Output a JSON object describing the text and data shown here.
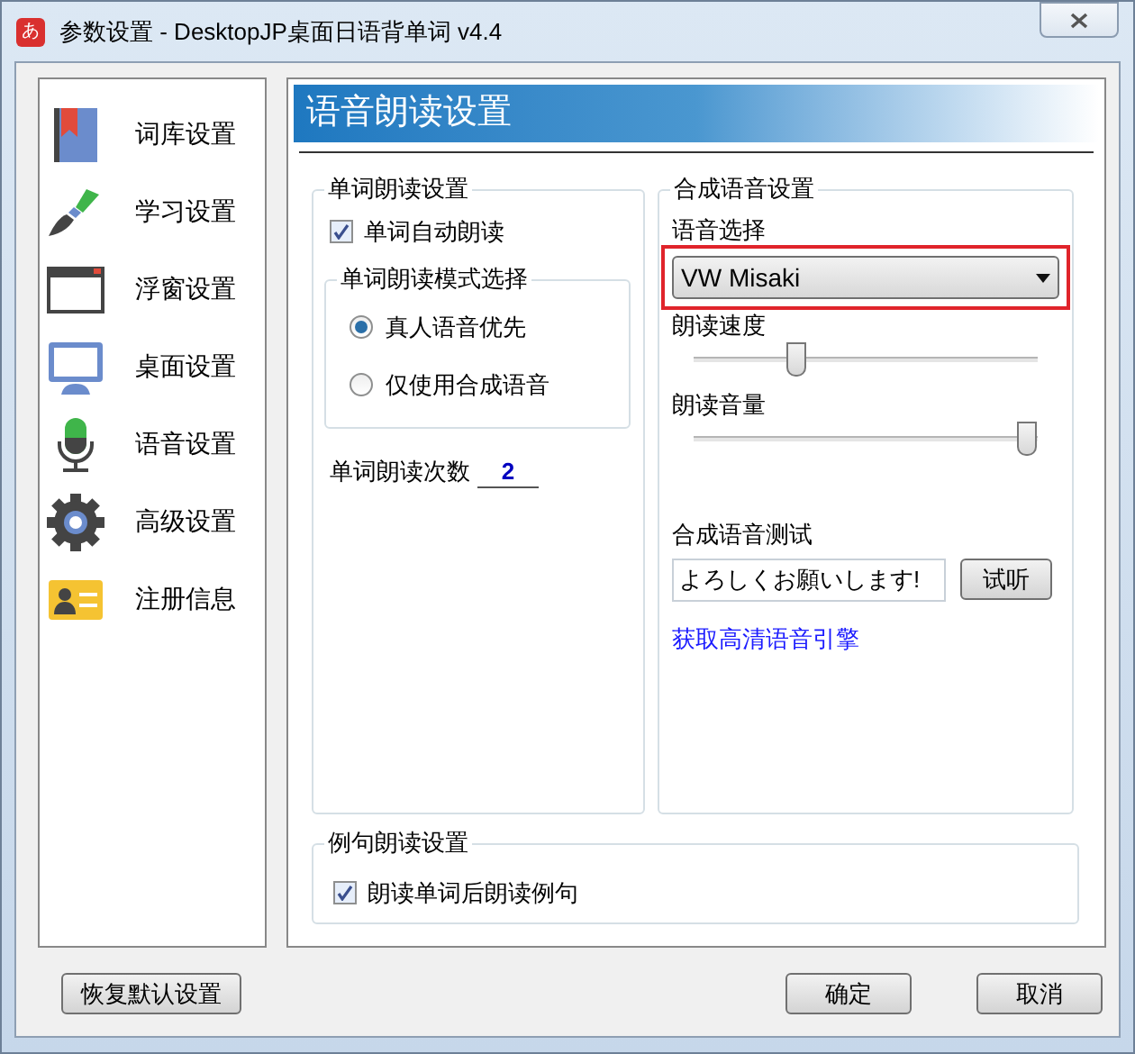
{
  "window": {
    "title": "参数设置 - DesktopJP桌面日语背单词 v4.4",
    "app_icon": "あ"
  },
  "sidebar": {
    "items": [
      {
        "label": "词库设置",
        "kind": "book"
      },
      {
        "label": "学习设置",
        "kind": "brush"
      },
      {
        "label": "浮窗设置",
        "kind": "window"
      },
      {
        "label": "桌面设置",
        "kind": "monitor"
      },
      {
        "label": "语音设置",
        "kind": "mic"
      },
      {
        "label": "高级设置",
        "kind": "gear"
      },
      {
        "label": "注册信息",
        "kind": "card"
      }
    ]
  },
  "header": "语音朗读设置",
  "word_group": {
    "title": "单词朗读设置",
    "auto_read": {
      "label": "单词自动朗读",
      "checked": true
    },
    "mode_group": {
      "title": "单词朗读模式选择",
      "options": [
        {
          "label": "真人语音优先",
          "selected": true
        },
        {
          "label": "仅使用合成语音",
          "selected": false
        }
      ]
    },
    "count_label": "单词朗读次数",
    "count_value": "2"
  },
  "tts_group": {
    "title": "合成语音设置",
    "voice_label": "语音选择",
    "voice_value": "VW Misaki",
    "voice_highlighted": true,
    "sliders": [
      {
        "label": "朗读速度",
        "level": 0.3
      },
      {
        "label": "朗读音量",
        "level": 0.97
      }
    ],
    "test_label": "合成语音测试",
    "test_text": "よろしくお願いします!",
    "test_button": "试听",
    "link": "获取高清语音引擎"
  },
  "example_group": {
    "title": "例句朗读设置",
    "option": {
      "label": "朗读单词后朗读例句",
      "checked": true
    }
  },
  "buttons": {
    "reset": "恢复默认设置",
    "ok": "确定",
    "cancel": "取消"
  }
}
